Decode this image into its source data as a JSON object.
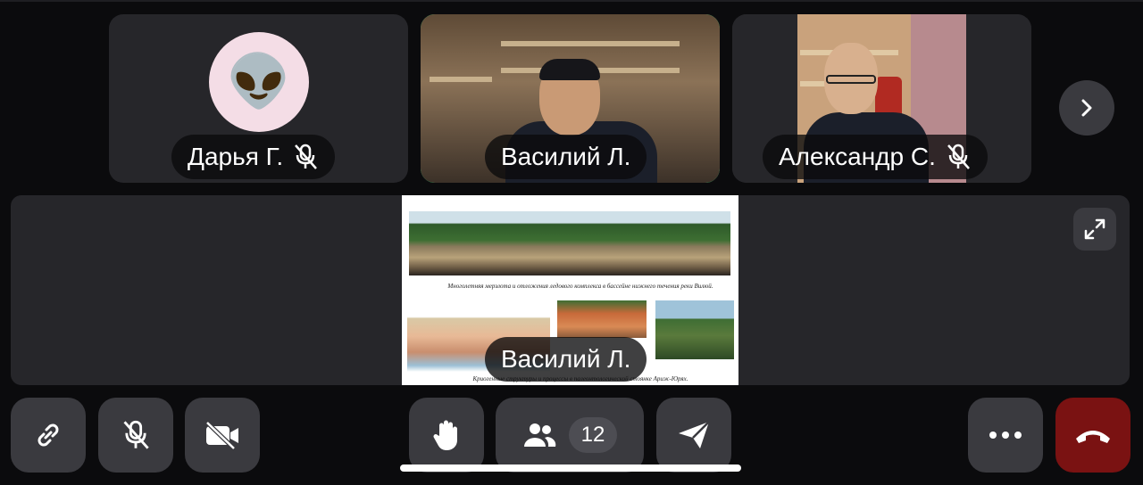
{
  "participants": [
    {
      "name": "Дарья Г.",
      "avatar": "alien-emoji",
      "avatar_glyph": "👽",
      "muted": true,
      "active": false
    },
    {
      "name": "Василий Л.",
      "muted": false,
      "active": true
    },
    {
      "name": "Александр С.",
      "muted": true,
      "active": false
    }
  ],
  "stage": {
    "presenter_name": "Василий Л.",
    "slide": {
      "caption_top": "Многолетняя мерзлота и отложения ледового комплекса в бассейне нижнего течения реки Вилюй.",
      "caption_bottom": "Криогенные структуры и процессы в палеонтологической стоянке Ариж-Юрях."
    }
  },
  "controls": {
    "participants_count": "12",
    "icons": [
      "link-icon",
      "mic-off-icon",
      "camera-off-icon",
      "raise-hand-icon",
      "people-icon",
      "send-icon",
      "more-icon",
      "hang-up-icon"
    ]
  },
  "colors": {
    "active_speaker_border": "#39d67a",
    "end_call": "#7a1212",
    "control_bg": "#3a3a3f",
    "tile_bg": "#26262a"
  }
}
